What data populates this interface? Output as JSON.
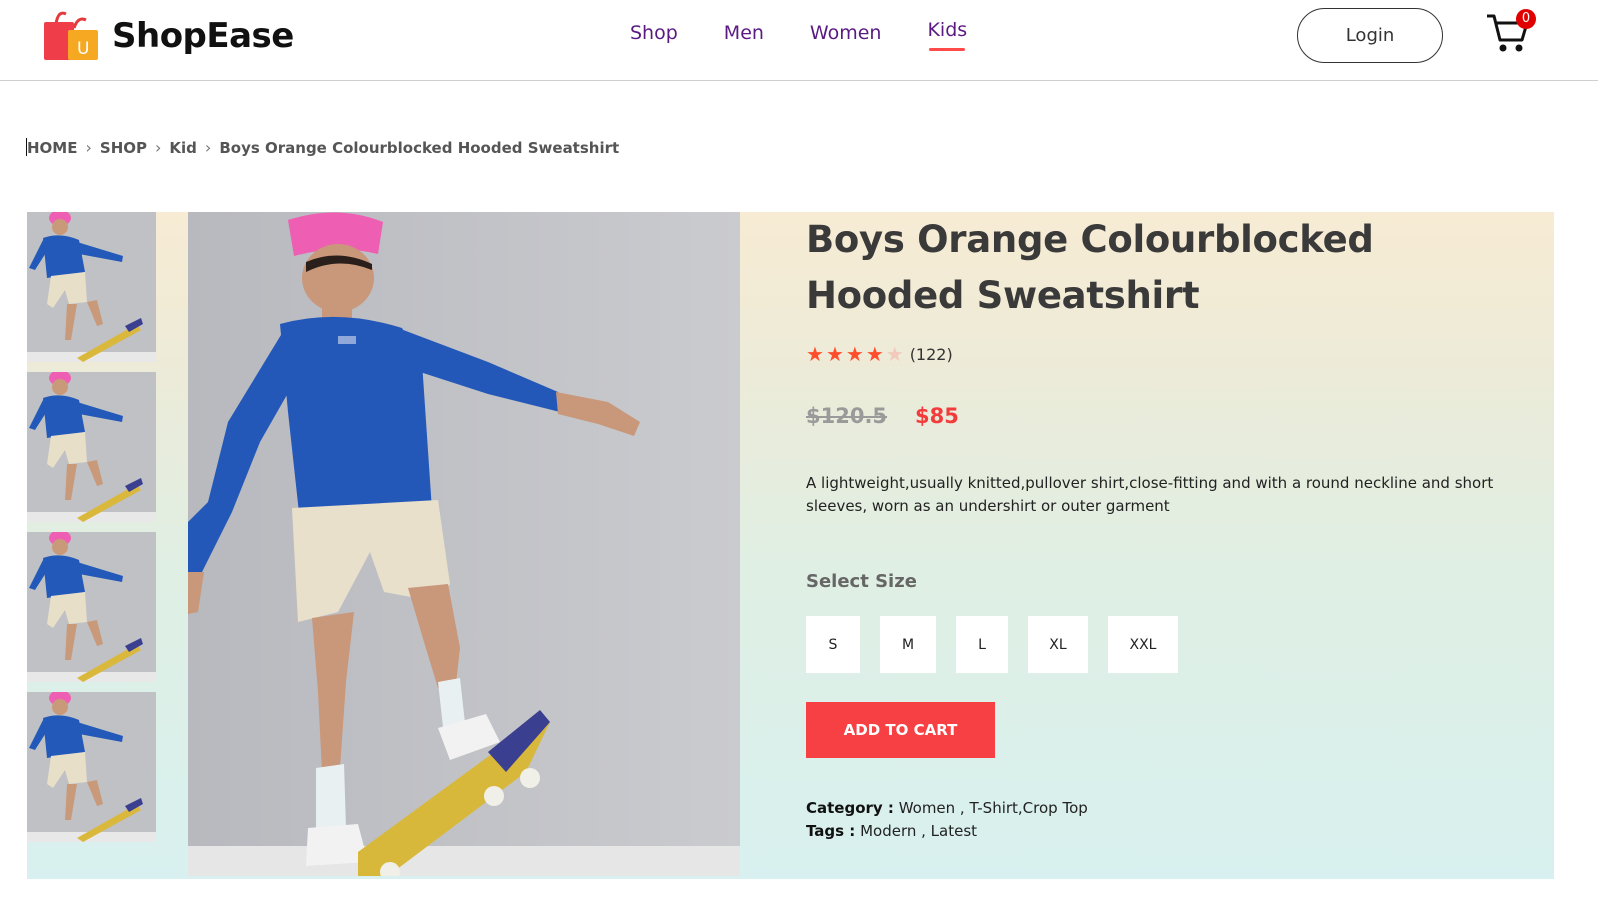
{
  "header": {
    "brand": "ShopEase",
    "logo_letter": "U",
    "nav": [
      {
        "label": "Shop"
      },
      {
        "label": "Men"
      },
      {
        "label": "Women"
      },
      {
        "label": "Kids",
        "active": true
      }
    ],
    "login_label": "Login",
    "cart_count": "0"
  },
  "breadcrumb": {
    "items": [
      "HOME",
      "SHOP",
      "Kid"
    ],
    "current": "Boys Orange Colourblocked Hooded Sweatshirt"
  },
  "product": {
    "title_line1": "Boys Orange Colourblocked",
    "title_line2": "Hooded Sweatshirt",
    "rating": 4,
    "rating_max": 5,
    "review_count": "(122)",
    "old_price": "$120.5",
    "price": "$85",
    "description": "A lightweight,usually knitted,pullover shirt,close-fitting and with a round neckline and short sleeves, worn as an undershirt or outer garment",
    "size_label": "Select Size",
    "sizes": [
      "S",
      "M",
      "L",
      "XL",
      "XXL"
    ],
    "add_to_cart_label": "ADD TO CART",
    "category_label": "Category :",
    "category_value": " Women , T-Shirt,Crop Top",
    "tags_label": "Tags :",
    "tags_value": " Modern , Latest",
    "thumbnail_count": 4
  },
  "colors": {
    "accent": "#f64044",
    "nav_text": "#5b1a82",
    "star": "#ff4e2b",
    "badge": "#e00000"
  }
}
